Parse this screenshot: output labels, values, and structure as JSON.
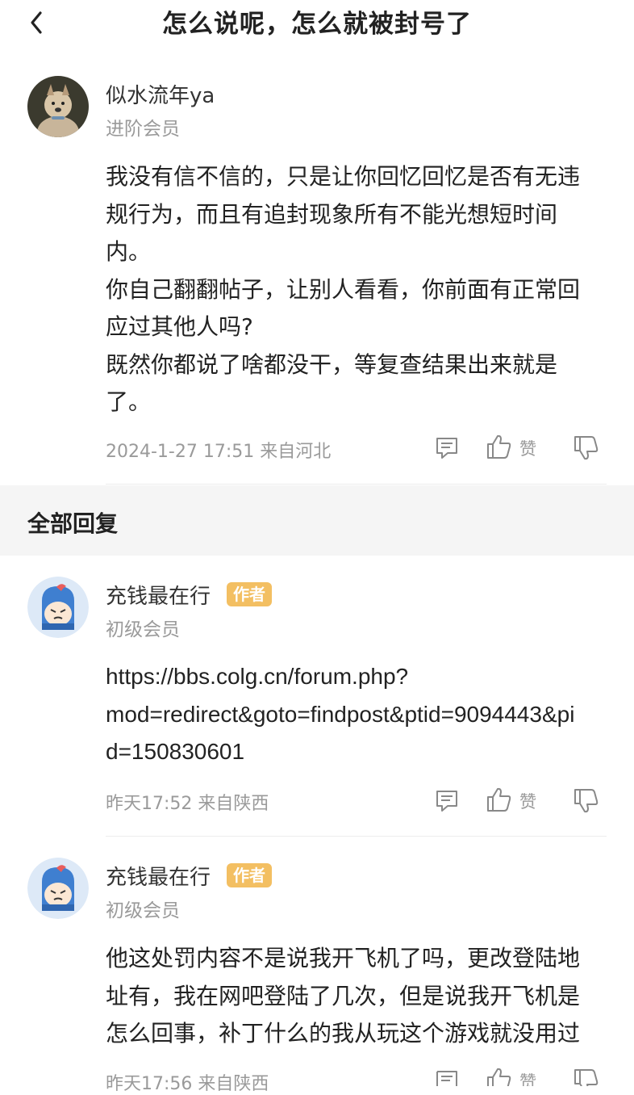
{
  "header": {
    "back_icon": "chevron-left-icon",
    "title": "怎么说呢，怎么就被封号了"
  },
  "main_post": {
    "username": "似水流年ya",
    "member_level": "进阶会员",
    "content": "我没有信不信的，只是让你回忆回忆是否有无违\n规行为，而且有追封现象所有不能光想短时间\n内。\n你自己翻翻帖子，让别人看看，你前面有正常回\n应过其他人吗?\n既然你都说了啥都没干，等复查结果出来就是\n了。",
    "timestamp": "2024-1-27 17:51 来自河北",
    "like_label": "赞"
  },
  "replies_section": {
    "title": "全部回复"
  },
  "replies": [
    {
      "username": "充钱最在行",
      "badge": "作者",
      "member_level": "初级会员",
      "content_lines": [
        "https://bbs.colg.cn/forum.php?",
        "mod=redirect&goto=findpost&ptid=9094443&pi",
        "d=150830601"
      ],
      "timestamp": "昨天17:52 来自陕西",
      "like_label": "赞"
    },
    {
      "username": "充钱最在行",
      "badge": "作者",
      "member_level": "初级会员",
      "content": "他这处罚内容不是说我开飞机了吗，更改登陆地\n址有，我在网吧登陆了几次，但是说我开飞机是\n怎么回事，补丁什么的我从玩这个游戏就没用过",
      "timestamp": "昨天17:56 来自陕西",
      "like_label": "赞"
    }
  ],
  "colors": {
    "badge": "#f3bf62",
    "section_band": "#f5f5f5",
    "muted_text": "#9a9a9a"
  }
}
